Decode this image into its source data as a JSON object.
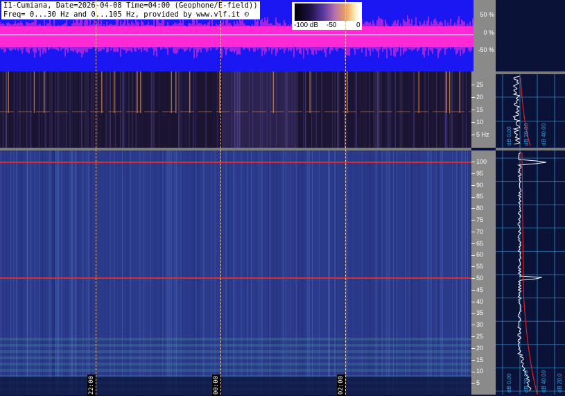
{
  "header": {
    "title_line1": "I1-Cumiana, Date=2026-04-08 Time=04:00 (Geophone/E-field))",
    "title_line2": "Freq= 0...30 Hz and 0...105 Hz, provided by www.vlf.it ©"
  },
  "colorbar": {
    "tick_min": "-100 dB",
    "tick_mid": "-50",
    "tick_max": "0"
  },
  "waveform_scale": {
    "t1": "50 %",
    "t2": "0 %",
    "t3": "-50 %"
  },
  "lf_scale": {
    "ticks": [
      "25",
      "20",
      "15",
      "10",
      "5 Hz"
    ]
  },
  "hf_scale": {
    "ticks": [
      "100",
      "95",
      "90",
      "85",
      "80",
      "75",
      "70",
      "65",
      "60",
      "55",
      "50",
      "45",
      "40",
      "35",
      "30",
      "25",
      "20",
      "15",
      "10",
      "5"
    ]
  },
  "time_markers": {
    "t1": "22:00",
    "t2": "00:00",
    "t3": "02:00"
  },
  "profile_panel": {
    "lf_labels": [
      "dB 0.00",
      "dB 20.00",
      "dB 40.00"
    ],
    "hf_labels": [
      "dB 0.00",
      "dB 20.00",
      "dB 40.00",
      "dB 20.0"
    ]
  },
  "colors": {
    "waveform_bg": "#1a17f2",
    "waveform_signal": "#ff2bd6",
    "spectrogram_bg": "#2b3a8a",
    "mains_line": "#d83030",
    "profile_trace": "#ffffff",
    "profile_fit": "#e02020",
    "grid": "#3aa0e0"
  }
}
